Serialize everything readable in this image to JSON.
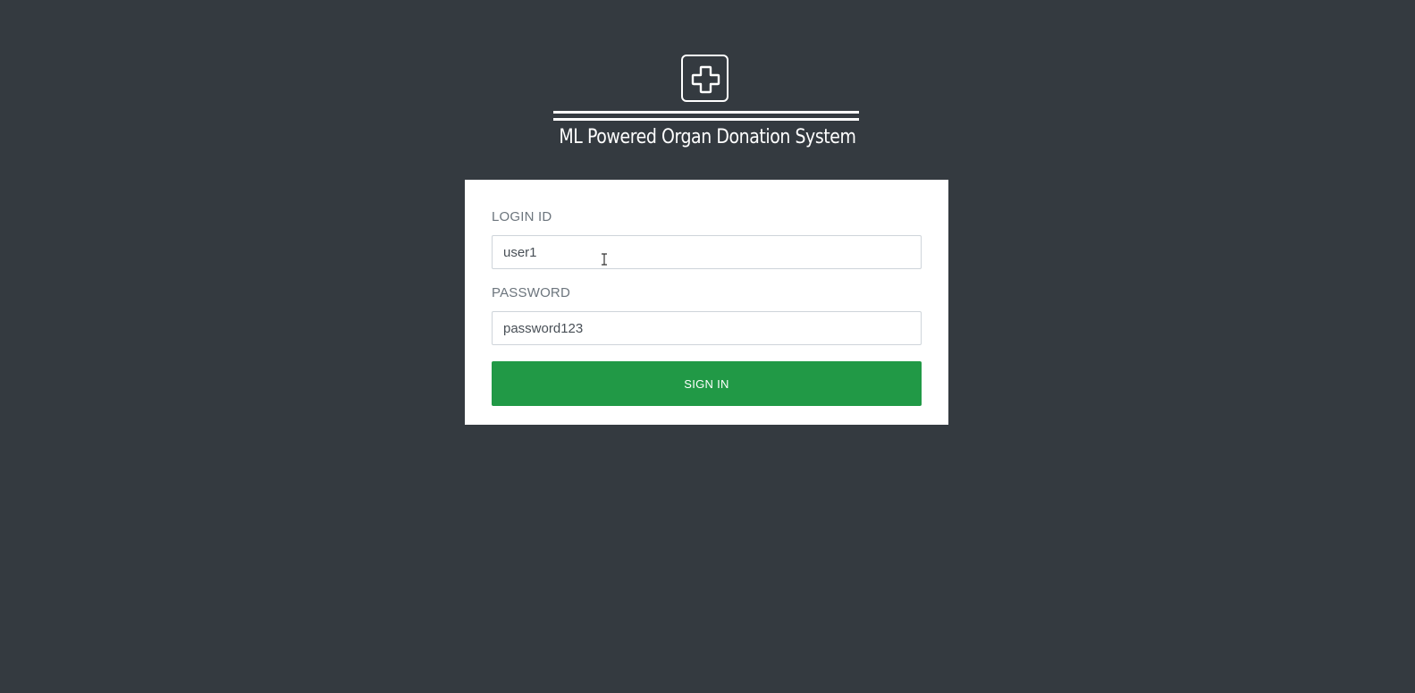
{
  "brand": {
    "logo_icon": "medical-cross-icon",
    "title": "ML Powered Organ Donation System"
  },
  "login_form": {
    "login_id_label": "LOGIN ID",
    "login_id_value": "user1",
    "password_label": "PASSWORD",
    "password_value": "password123",
    "submit_label": "SIGN IN"
  },
  "colors": {
    "background": "#343a40",
    "card": "#ffffff",
    "primary_button": "#219946"
  }
}
